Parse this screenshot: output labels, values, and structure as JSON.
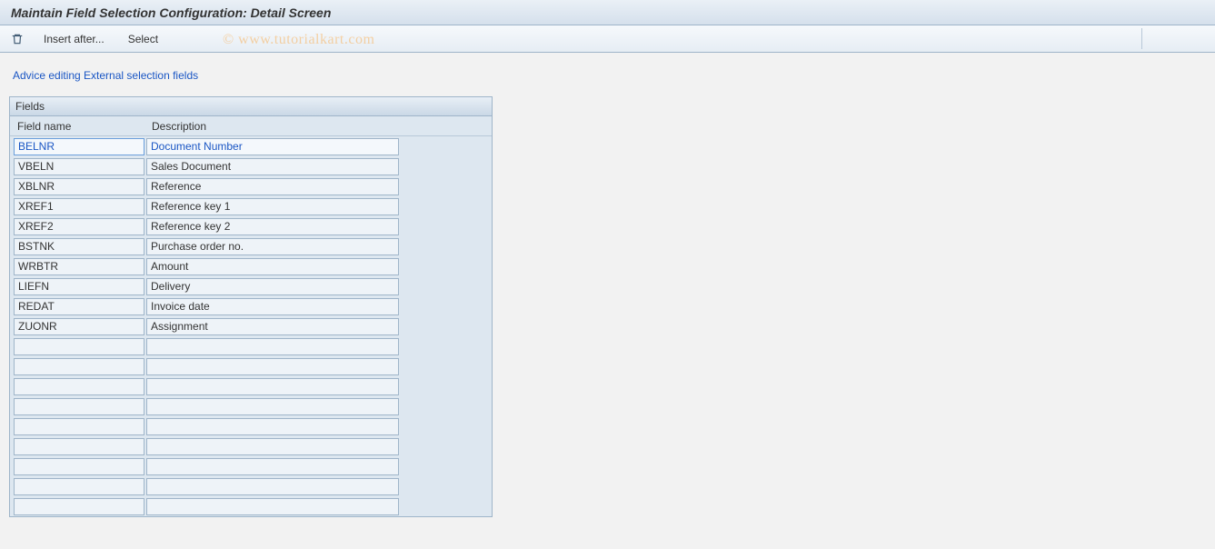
{
  "title": "Maintain Field Selection Configuration: Detail Screen",
  "toolbar": {
    "insert_after_label": "Insert after...",
    "select_label": "Select"
  },
  "watermark": "© www.tutorialkart.com",
  "breadcrumb": "Advice editing External selection fields",
  "panel": {
    "title": "Fields",
    "columns": {
      "name": "Field name",
      "desc": "Description"
    }
  },
  "rows": [
    {
      "name": "BELNR",
      "desc": "Document Number",
      "selected": true
    },
    {
      "name": "VBELN",
      "desc": "Sales Document",
      "selected": false
    },
    {
      "name": "XBLNR",
      "desc": "Reference",
      "selected": false
    },
    {
      "name": "XREF1",
      "desc": "Reference key 1",
      "selected": false
    },
    {
      "name": "XREF2",
      "desc": "Reference key 2",
      "selected": false
    },
    {
      "name": "BSTNK",
      "desc": "Purchase order no.",
      "selected": false
    },
    {
      "name": "WRBTR",
      "desc": "Amount",
      "selected": false
    },
    {
      "name": "LIEFN",
      "desc": "Delivery",
      "selected": false
    },
    {
      "name": "REDAT",
      "desc": "Invoice date",
      "selected": false
    },
    {
      "name": "ZUONR",
      "desc": "Assignment",
      "selected": false
    },
    {
      "name": "",
      "desc": "",
      "selected": false
    },
    {
      "name": "",
      "desc": "",
      "selected": false
    },
    {
      "name": "",
      "desc": "",
      "selected": false
    },
    {
      "name": "",
      "desc": "",
      "selected": false
    },
    {
      "name": "",
      "desc": "",
      "selected": false
    },
    {
      "name": "",
      "desc": "",
      "selected": false
    },
    {
      "name": "",
      "desc": "",
      "selected": false
    },
    {
      "name": "",
      "desc": "",
      "selected": false
    },
    {
      "name": "",
      "desc": "",
      "selected": false
    }
  ]
}
